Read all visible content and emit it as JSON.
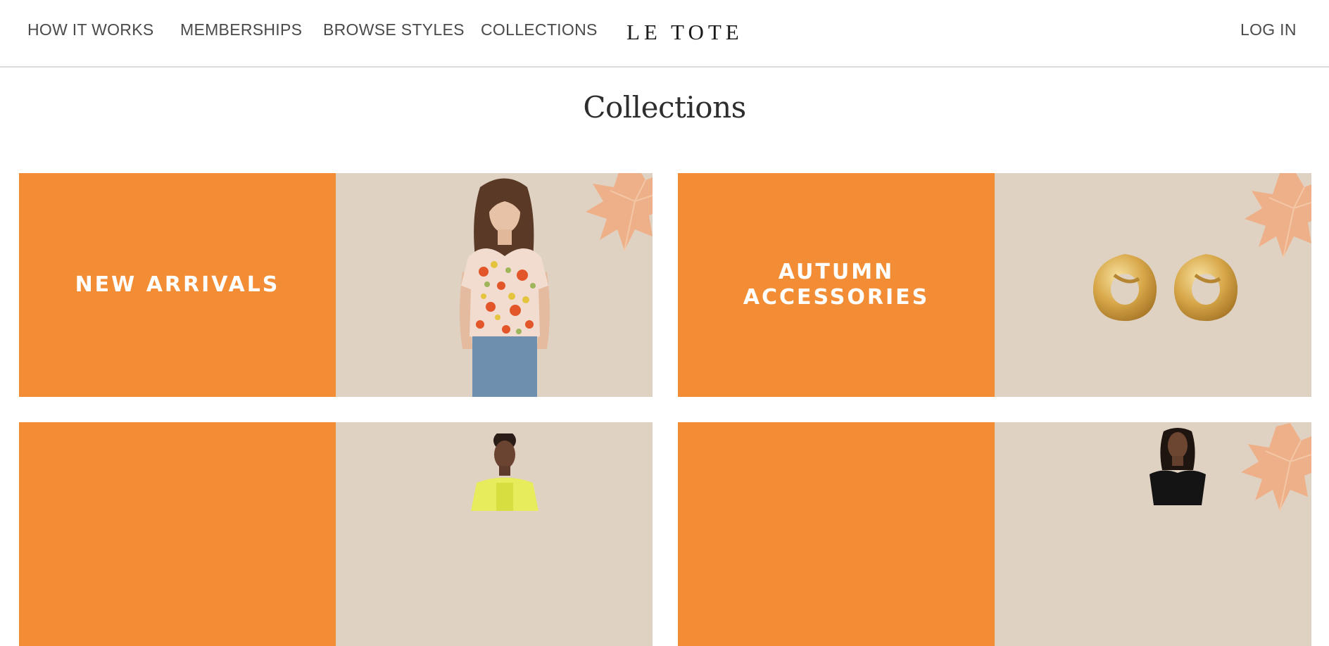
{
  "nav": {
    "how_it_works": "HOW IT WORKS",
    "memberships": "MEMBERSHIPS",
    "browse_styles": "BROWSE STYLES",
    "collections": "COLLECTIONS",
    "logo": "LE TOTE",
    "log_in": "LOG IN"
  },
  "page": {
    "title": "Collections"
  },
  "cards": [
    {
      "label_lines": [
        "NEW ARRIVALS"
      ]
    },
    {
      "label_lines": [
        "AUTUMN",
        "ACCESSORIES"
      ]
    },
    {
      "label_lines": []
    },
    {
      "label_lines": []
    }
  ],
  "colors": {
    "accent_orange": "#f28c35",
    "panel_beige": "#e0d2c3",
    "leaf": "#eeb088",
    "nav_text": "#4a4a4a"
  },
  "icons": {
    "leaf": "maple-leaf-icon"
  }
}
